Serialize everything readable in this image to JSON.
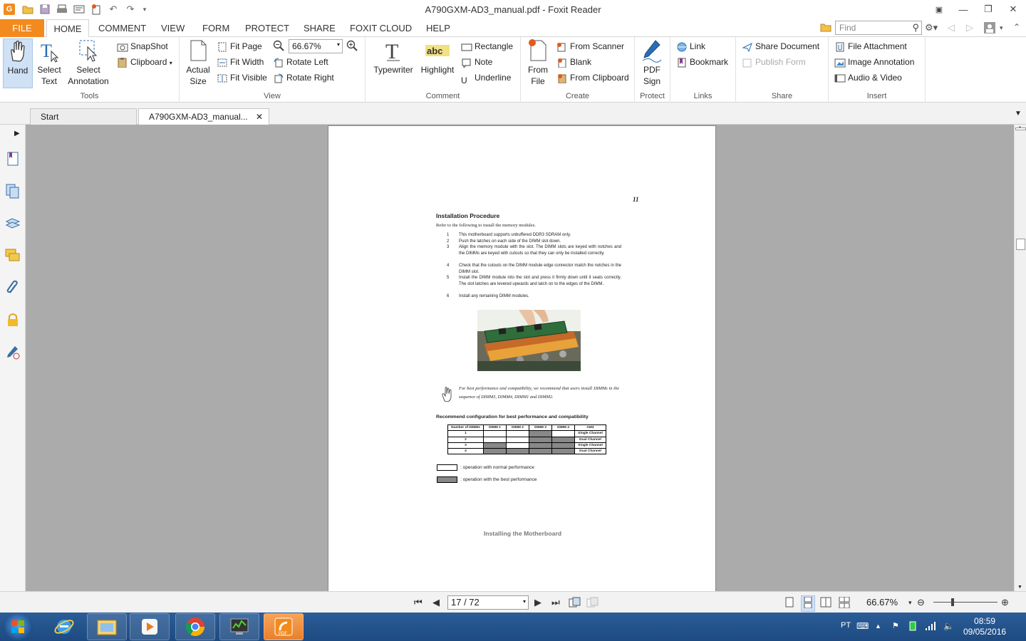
{
  "window": {
    "title": "A790GXM-AD3_manual.pdf - Foxit Reader"
  },
  "ribbon_tabs": [
    "FILE",
    "HOME",
    "COMMENT",
    "VIEW",
    "FORM",
    "PROTECT",
    "SHARE",
    "FOXIT CLOUD",
    "HELP"
  ],
  "find": {
    "placeholder": "Find"
  },
  "tools_group": {
    "label": "Tools",
    "hand": "Hand",
    "select_text": [
      "Select",
      "Text"
    ],
    "select_annotation": [
      "Select",
      "Annotation"
    ],
    "snapshot": "SnapShot",
    "clipboard": "Clipboard"
  },
  "view_group": {
    "label": "View",
    "actual_size": [
      "Actual",
      "Size"
    ],
    "fit_page": "Fit Page",
    "fit_width": "Fit Width",
    "fit_visible": "Fit Visible",
    "zoom_value": "66.67%",
    "rotate_left": "Rotate Left",
    "rotate_right": "Rotate Right"
  },
  "comment_group": {
    "label": "Comment",
    "typewriter": "Typewriter",
    "highlight": "Highlight",
    "highlight_icon_text": "abc",
    "rectangle": "Rectangle",
    "note": "Note",
    "underline": "Underline"
  },
  "create_group": {
    "label": "Create",
    "from_file": [
      "From",
      "File"
    ],
    "from_scanner": "From Scanner",
    "blank": "Blank",
    "from_clipboard": "From Clipboard"
  },
  "protect_group": {
    "label": "Protect",
    "pdf_sign": [
      "PDF",
      "Sign"
    ]
  },
  "links_group": {
    "label": "Links",
    "link": "Link",
    "bookmark": "Bookmark"
  },
  "share_group": {
    "label": "Share",
    "share_document": "Share Document",
    "publish_form": "Publish Form"
  },
  "insert_group": {
    "label": "Insert",
    "file_attachment": "File Attachment",
    "image_annotation": "Image Annotation",
    "audio_video": "Audio & Video"
  },
  "doc_tabs": {
    "start": "Start",
    "active": "A790GXM-AD3_manual..."
  },
  "pdf_page": {
    "page_number": "11",
    "title": "Installation Procedure",
    "intro": "Refer to the following to install the memory modules.",
    "steps": [
      {
        "n": "1",
        "text": "This motherboard supports unbuffered DDR3 SDRAM only."
      },
      {
        "n": "2",
        "text": "Push the latches on each side of the DIMM slot down."
      },
      {
        "n": "3",
        "text": "Align the memory module with the slot. The DIMM slots are keyed with notches and the DIMMs are keyed with cutouts so that they can only be installed correctly."
      },
      {
        "n": "4",
        "text": "Check that the cutouts on the DIMM module edge connector match the notches in the DIMM slot."
      },
      {
        "n": "5",
        "text": "Install the DIMM module into the slot and press it firmly down until it seats correctly. The slot latches are levered upwards and latch on to the edges of the DIMM."
      },
      {
        "n": "6",
        "text": "Install any remaining DIMM modules."
      }
    ],
    "tip": "For best performance and compatibility, we recommend that users install DIMMs in the sequence of DIMM3, DIMM4, DIMM1 and  DIMM2.",
    "table_title": "Recommend configuration for best performance and compatibility",
    "table_headers": [
      "Number of DIMMs",
      "DIMM 1",
      "DIMM 2",
      "DIMM 3",
      "DIMM 4",
      "AM3"
    ],
    "table_rows": [
      {
        "num": "1",
        "shaded": [
          false,
          false,
          true,
          false
        ],
        "am3": "Single Channel"
      },
      {
        "num": "2",
        "shaded": [
          false,
          false,
          true,
          true
        ],
        "am3": "Dual Channel"
      },
      {
        "num": "3",
        "shaded": [
          true,
          false,
          true,
          true
        ],
        "am3": "Single Channel"
      },
      {
        "num": "4",
        "shaded": [
          true,
          true,
          true,
          true
        ],
        "am3": "Dual Channel"
      }
    ],
    "legend_normal": ": operation with normal performance",
    "legend_best": ": operation with the best performance",
    "footer": "Installing the Motherboard"
  },
  "statusbar": {
    "page_indicator": "17 / 72",
    "zoom": "66.67%"
  },
  "taskbar": {
    "lang": "PT",
    "time": "08:59",
    "date": "09/05/2016"
  },
  "colors": {
    "accent_orange": "#f28a1e",
    "workspace_gray": "#ababab",
    "taskbar_blue": "#1d4a80"
  }
}
